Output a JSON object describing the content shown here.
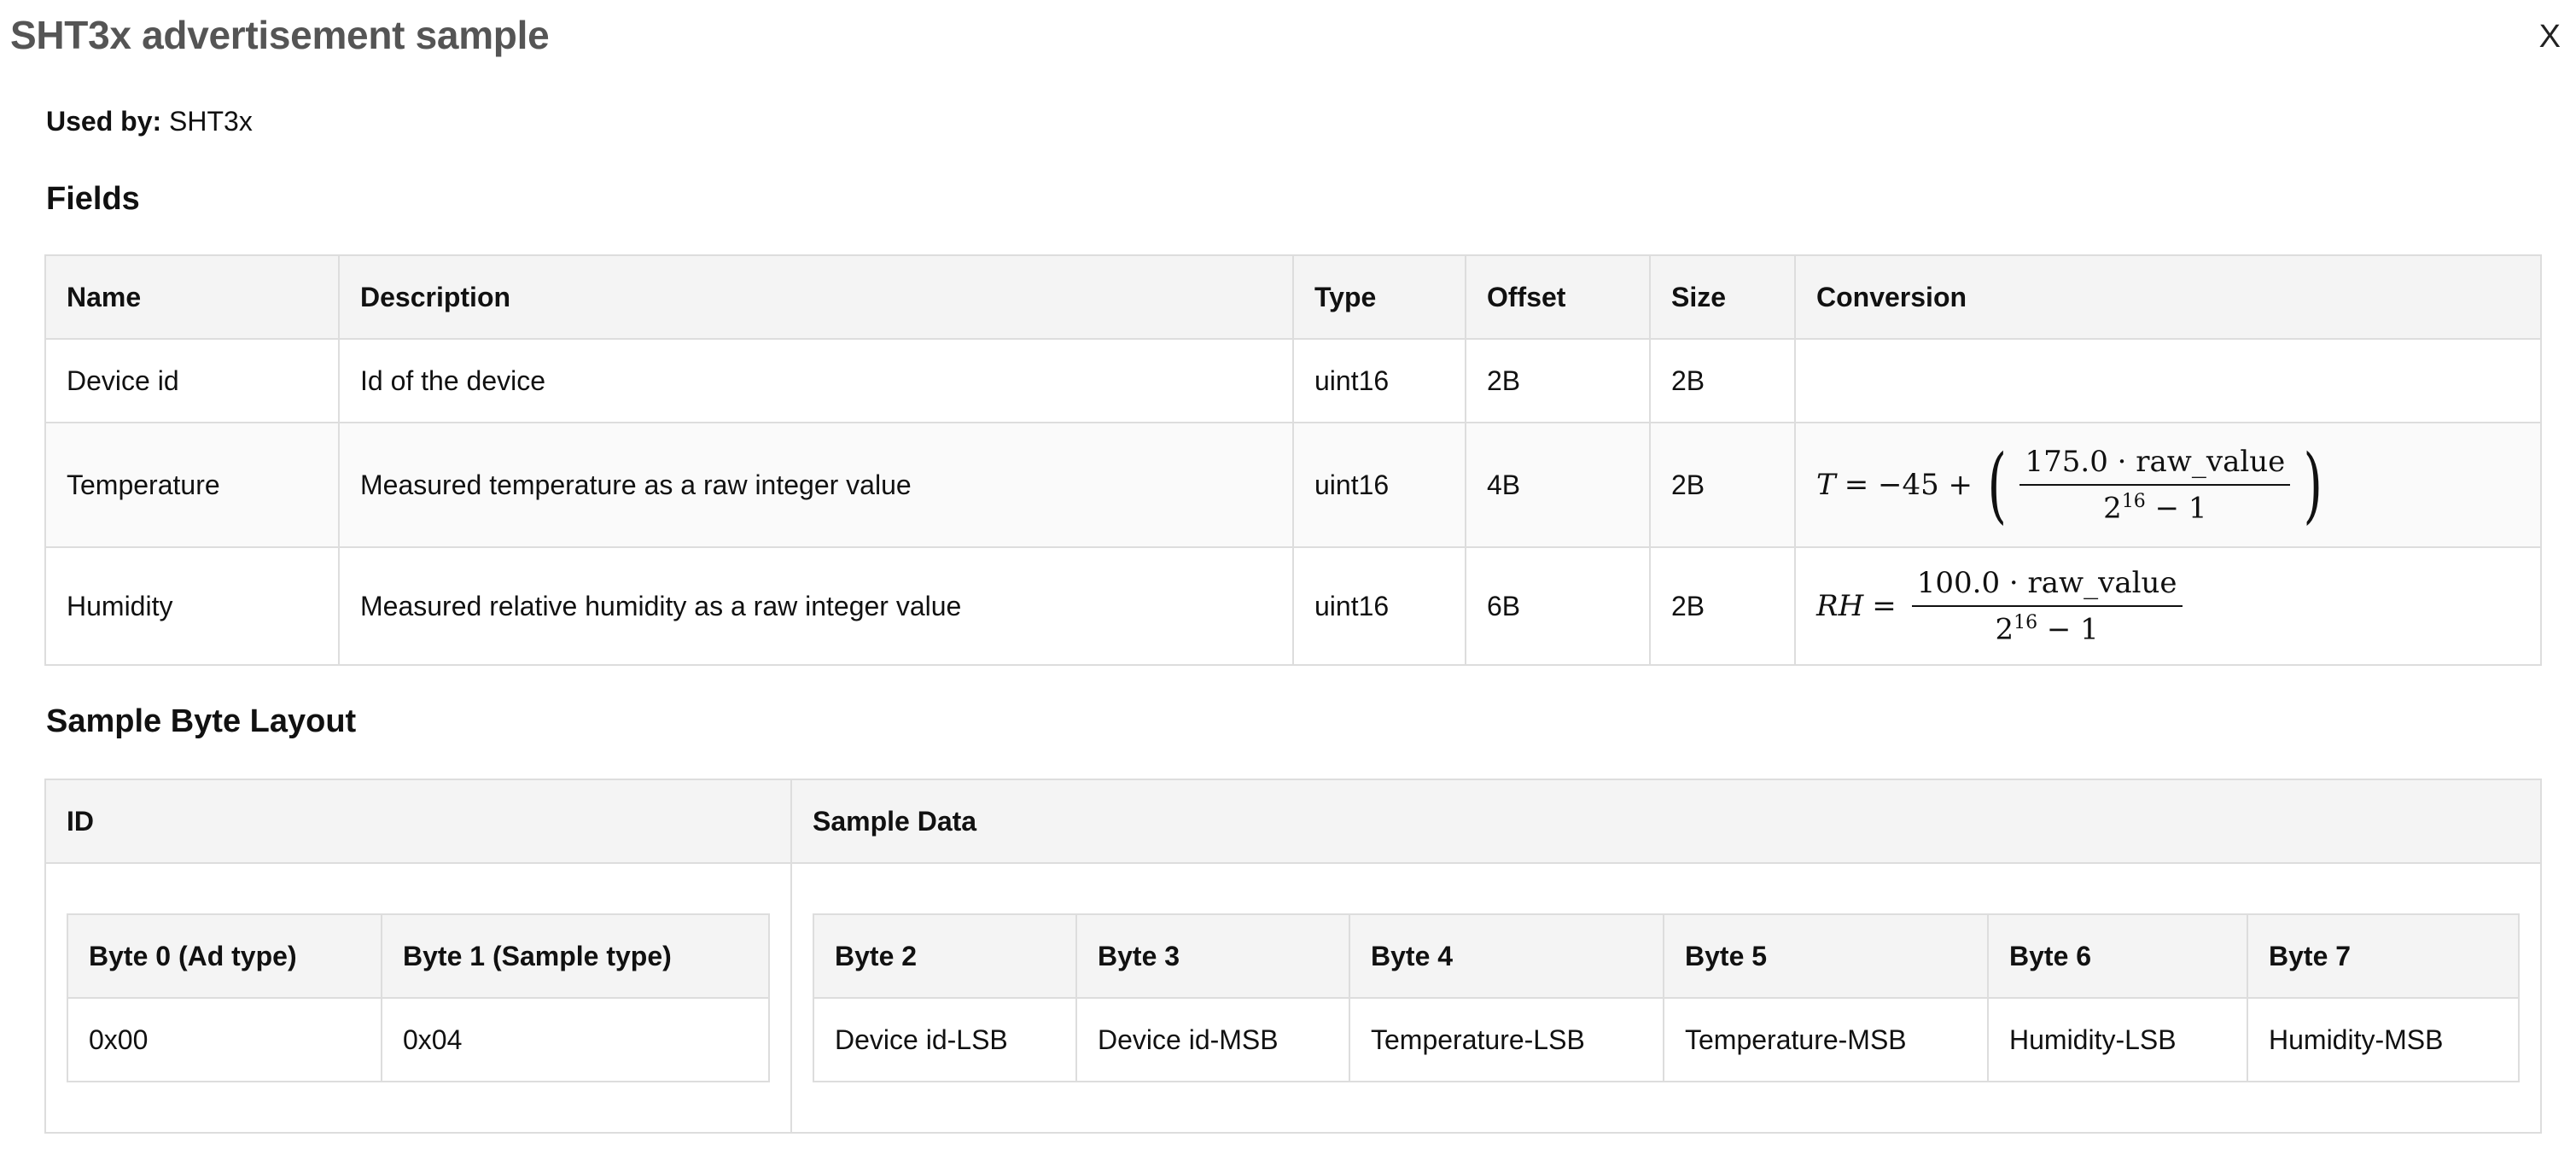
{
  "dialog": {
    "title": "SHT3x advertisement sample",
    "close_label": "X"
  },
  "used_by": {
    "label": "Used by:",
    "value": "SHT3x"
  },
  "fields": {
    "heading": "Fields",
    "columns": [
      "Name",
      "Description",
      "Type",
      "Offset",
      "Size",
      "Conversion"
    ],
    "rows": [
      {
        "name": "Device id",
        "description": "Id of the device",
        "type": "uint16",
        "offset": "2B",
        "size": "2B",
        "conversion": ""
      },
      {
        "name": "Temperature",
        "description": "Measured temperature as a raw integer value",
        "type": "uint16",
        "offset": "4B",
        "size": "2B",
        "conversion": {
          "lhs": "T",
          "eq": "= −45 +",
          "numerator": "175.0 · raw_value",
          "denominator_base": "2",
          "denominator_exp": "16",
          "denominator_rest": " − 1"
        }
      },
      {
        "name": "Humidity",
        "description": "Measured relative humidity as a raw integer value",
        "type": "uint16",
        "offset": "6B",
        "size": "2B",
        "conversion": {
          "lhs": "RH",
          "eq": "=",
          "numerator": "100.0 · raw_value",
          "denominator_base": "2",
          "denominator_exp": "16",
          "denominator_rest": " − 1"
        }
      }
    ]
  },
  "byte_layout": {
    "heading": "Sample Byte Layout",
    "columns": [
      "ID",
      "Sample Data"
    ],
    "id_table": {
      "headers": [
        "Byte 0 (Ad type)",
        "Byte 1 (Sample type)"
      ],
      "values": [
        "0x00",
        "0x04"
      ]
    },
    "data_table": {
      "headers": [
        "Byte 2",
        "Byte 3",
        "Byte 4",
        "Byte 5",
        "Byte 6",
        "Byte 7"
      ],
      "values": [
        "Device id-LSB",
        "Device id-MSB",
        "Temperature-LSB",
        "Temperature-MSB",
        "Humidity-LSB",
        "Humidity-MSB"
      ]
    }
  }
}
